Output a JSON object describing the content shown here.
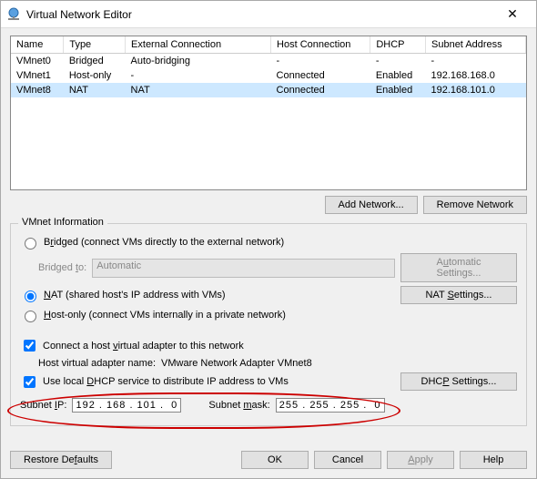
{
  "window": {
    "title": "Virtual Network Editor"
  },
  "table": {
    "headers": [
      "Name",
      "Type",
      "External Connection",
      "Host Connection",
      "DHCP",
      "Subnet Address"
    ],
    "rows": [
      {
        "name": "VMnet0",
        "type": "Bridged",
        "ext": "Auto-bridging",
        "host": "-",
        "dhcp": "-",
        "subnet": "-",
        "selected": false
      },
      {
        "name": "VMnet1",
        "type": "Host-only",
        "ext": "-",
        "host": "Connected",
        "dhcp": "Enabled",
        "subnet": "192.168.168.0",
        "selected": false
      },
      {
        "name": "VMnet8",
        "type": "NAT",
        "ext": "NAT",
        "host": "Connected",
        "dhcp": "Enabled",
        "subnet": "192.168.101.0",
        "selected": true
      }
    ]
  },
  "buttons": {
    "add_network": "Add Network...",
    "remove_network": "Remove Network",
    "automatic_settings": "Automatic Settings...",
    "nat_settings": "NAT Settings...",
    "dhcp_settings": "DHCP Settings...",
    "restore_defaults": "Restore Defaults",
    "ok": "OK",
    "cancel": "Cancel",
    "apply": "Apply",
    "help": "Help"
  },
  "info": {
    "title": "VMnet Information",
    "bridged_label": "Bridged (connect VMs directly to the external network)",
    "bridged_to": "Bridged to:",
    "bridged_to_value": "Automatic",
    "nat_label": "NAT (shared host's IP address with VMs)",
    "hostonly_label": "Host-only (connect VMs internally in a private network)",
    "connect_host_adapter": "Connect a host virtual adapter to this network",
    "host_adapter_name_label": "Host virtual adapter name:",
    "host_adapter_name_value": "VMware Network Adapter VMnet8",
    "use_dhcp": "Use local DHCP service to distribute IP address to VMs",
    "subnet_ip_label": "Subnet IP:",
    "subnet_ip_value": "192 . 168 . 101 .  0",
    "subnet_mask_label": "Subnet mask:",
    "subnet_mask_value": "255 . 255 . 255 .  0"
  }
}
